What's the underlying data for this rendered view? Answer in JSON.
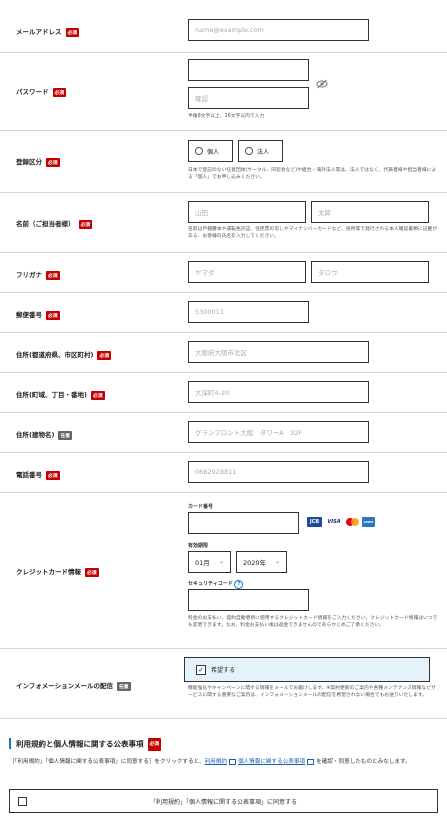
{
  "badges": {
    "required": "必須",
    "optional": "任意"
  },
  "email": {
    "label": "メールアドレス",
    "placeholder": "name@example.com"
  },
  "password": {
    "label": "パスワード",
    "confirm_placeholder": "確認",
    "help": "半角8文字以上、16文字以内で入力"
  },
  "registration_type": {
    "label": "登録区分",
    "options": [
      "個人",
      "法人"
    ],
    "help": "日本で登記のない任意団体(サークル、同窓会など)や組合・海外法人等は、法人ではなく、代表者様や担当者様による「個人」でお申し込みください。"
  },
  "name": {
    "label": "名前（ご担当者様）",
    "last_placeholder": "山田",
    "first_placeholder": "太郎",
    "help": "名前は戸籍謄本や運転免許証、住民票の写しやマイナンバーカードなど、役所等で発行される本人確認書類に記載がある、お客様の氏名を入力してください。"
  },
  "furigana": {
    "label": "フリガナ",
    "last_placeholder": "ヤマダ",
    "first_placeholder": "タロウ"
  },
  "postal": {
    "label": "郵便番号",
    "placeholder": "5300011"
  },
  "address1": {
    "label": "住所(都道府県、市区町村)",
    "placeholder": "大阪府大阪市北区"
  },
  "address2": {
    "label": "住所(町域、丁目・番地)",
    "placeholder": "大深町4-20"
  },
  "address3": {
    "label": "住所(建物名)",
    "placeholder": "グランフロント大阪　タワーA　32F"
  },
  "phone": {
    "label": "電話番号",
    "placeholder": "0682928811"
  },
  "credit": {
    "label": "クレジットカード情報",
    "card_number_label": "カード番号",
    "expiry_label": "有効期限",
    "month": "01月",
    "year": "2020年",
    "security_label": "セキュリティコード",
    "help_icon": "?",
    "brands": [
      "JCB",
      "VISA",
      "MC",
      "AMEX"
    ],
    "help": "料金のお支払い、契約自動更新に使用するクレジットカード情報をご入力ください。クレジットカード情報はいつでも変更できます。なお、料金お支払い後は返金できませんのであらかじめご了承ください。"
  },
  "newsletter": {
    "label": "インフォメーションメールの配信",
    "checkbox_label": "希望する",
    "checked": true,
    "help": "機能強化やキャンペーンに関する情報をメールでお届けします。※契約更新のご案内や各種メンテナンス情報などサービスに関する重要なご案内は、インフォメーションメールの配信を希望されない場合でもお送りいたします。"
  },
  "terms": {
    "title": "利用規約と個人情報に関する公表事項",
    "text_prefix": "［「利用規約」「個人情報に関する公表事項」に同意する］をクリックすると、",
    "link1": "利用規約",
    "link2": "個人情報に関する公表事項",
    "text_suffix": "を確認・同意したものとみなします。",
    "agree_label": "「利用規約」「個人情報に関する公表事項」に同意する"
  },
  "colors": {
    "required_badge": "#c40000",
    "optional_badge": "#666666",
    "checkbox_bg": "#e4f3fb",
    "link": "#1a5fb4"
  }
}
